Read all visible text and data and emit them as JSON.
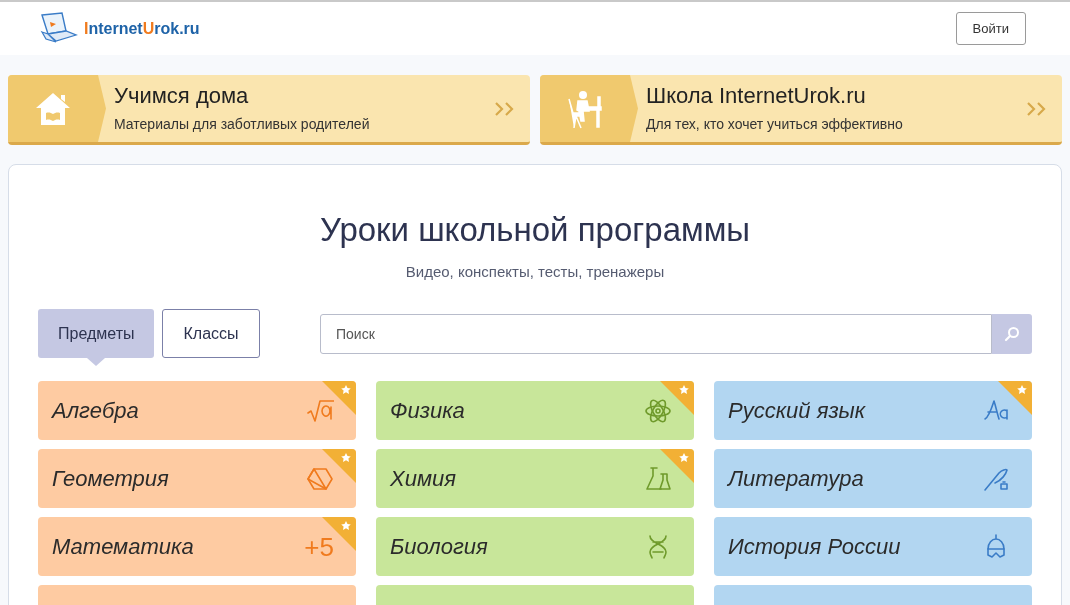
{
  "header": {
    "logo": {
      "parts": [
        {
          "text": "I",
          "accent": true
        },
        {
          "text": "nternet",
          "accent": false
        },
        {
          "text": "U",
          "accent": true
        },
        {
          "text": "rok.ru",
          "accent": false
        }
      ]
    },
    "login_button": "Войти"
  },
  "banners": [
    {
      "title": "Учимся дома",
      "subtitle": "Материалы для заботливых родителей"
    },
    {
      "title": "Школа InternetUrok.ru",
      "subtitle": "Для тех, кто хочет учиться эффективно"
    }
  ],
  "lessons": {
    "title": "Уроки школьной программы",
    "subtitle": "Видео, конспекты, тесты, тренажеры",
    "tabs": [
      {
        "label": "Предметы",
        "selected": true
      },
      {
        "label": "Классы",
        "selected": false
      }
    ],
    "search": {
      "placeholder": "Поиск"
    },
    "columns": [
      {
        "color": "#fecba2",
        "subjects": [
          {
            "name": "Алгебра",
            "starred": true
          },
          {
            "name": "Геометрия",
            "starred": true
          },
          {
            "name": "Математика",
            "starred": true,
            "icon_text": "+5"
          },
          {
            "starred": false
          }
        ]
      },
      {
        "color": "#c8e69a",
        "subjects": [
          {
            "name": "Физика",
            "starred": true
          },
          {
            "name": "Химия",
            "starred": true
          },
          {
            "name": "Биология",
            "starred": false
          },
          {
            "starred": false
          }
        ]
      },
      {
        "color": "#b2d6f1",
        "subjects": [
          {
            "name": "Русский язык",
            "starred": true
          },
          {
            "name": "Литература",
            "starred": false
          },
          {
            "name": "История России",
            "starred": false
          },
          {
            "starred": false
          }
        ]
      }
    ]
  }
}
